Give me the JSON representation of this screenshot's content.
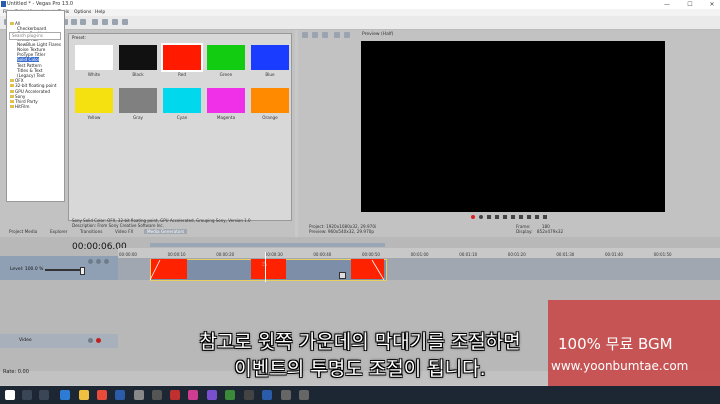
{
  "app": {
    "title": "Untitled * - Vegas Pro 13.0"
  },
  "window_controls": {
    "minimize": "—",
    "maximize": "☐",
    "close": "✕"
  },
  "menu": [
    "File",
    "Edit",
    "View",
    "Insert",
    "Tools",
    "Options",
    "Help"
  ],
  "tree": {
    "search_placeholder": "Search plug-ins",
    "items": [
      "All",
      "Checkerboard",
      "Color Gradient",
      "Credit Roll",
      "NewBlue Light Flares",
      "Noise Texture",
      "ProType Titler",
      "Solid Color",
      "Test Pattern",
      "Titles & Text",
      "(Legacy) Text",
      "OFX",
      "32-bit floating point",
      "GPU Accelerated",
      "Sony",
      "Third Party",
      "HitFilm"
    ],
    "selected_index": 7
  },
  "preset": {
    "label": "Preset:",
    "swatches": [
      {
        "name": "White",
        "color": "#ffffff"
      },
      {
        "name": "Black",
        "color": "#111111"
      },
      {
        "name": "Red",
        "color": "#ff1a00"
      },
      {
        "name": "Green",
        "color": "#11cc11"
      },
      {
        "name": "Blue",
        "color": "#1a3cff"
      },
      {
        "name": "Yellow",
        "color": "#f5e010"
      },
      {
        "name": "Gray",
        "color": "#808080"
      },
      {
        "name": "Cyan",
        "color": "#00d8ee"
      },
      {
        "name": "Magenta",
        "color": "#f030e8"
      },
      {
        "name": "Orange",
        "color": "#ff8a00"
      }
    ],
    "selected_index": 2
  },
  "description": {
    "line1": "Sony Solid Color: OFX, 32-bit floating point, GPU Accelerated, Grouping Sony, Version 1.0",
    "line2": "Description: From Sony Creative Software Inc."
  },
  "panel_tabs": [
    "Project Media",
    "Explorer",
    "Transitions",
    "Video FX",
    "Media Generators"
  ],
  "preview": {
    "label": "Preview (Half)",
    "project": "Project:  1920x1080x32, 29.970i",
    "preview_info": "Preview:  960x540x32, 29.970p",
    "frame_label": "Frame:",
    "frame_value": "180",
    "display_label": "Display:",
    "display_value": "852x479x32"
  },
  "timeline": {
    "timecode": "00:00:06.00",
    "ticks": [
      "00:00:00",
      "00:00:10",
      "00:00:20",
      "00:00:30",
      "00:00:40",
      "00:00:50",
      "00:01:00",
      "00:01:10",
      "00:01:20",
      "00:01:30",
      "00:01:40",
      "00:01:50"
    ],
    "track1_level": "Level: 100.0 %",
    "track2_label": "Video",
    "rate": "Rate: 0.00"
  },
  "subtitle": {
    "line1": "참고로 윗쪽 가운데의 막대기를 조절하면",
    "line2": "이벤트의 투명도 조절이 됩니다."
  },
  "watermark": {
    "line1": "100% 무료 BGM",
    "line2": "www.yoonbumtae.com",
    "bg": "#c84646"
  },
  "colors": {
    "event_red": "#ff2200",
    "event_base": "#7d8fa8",
    "event_border": "#e8d060"
  }
}
